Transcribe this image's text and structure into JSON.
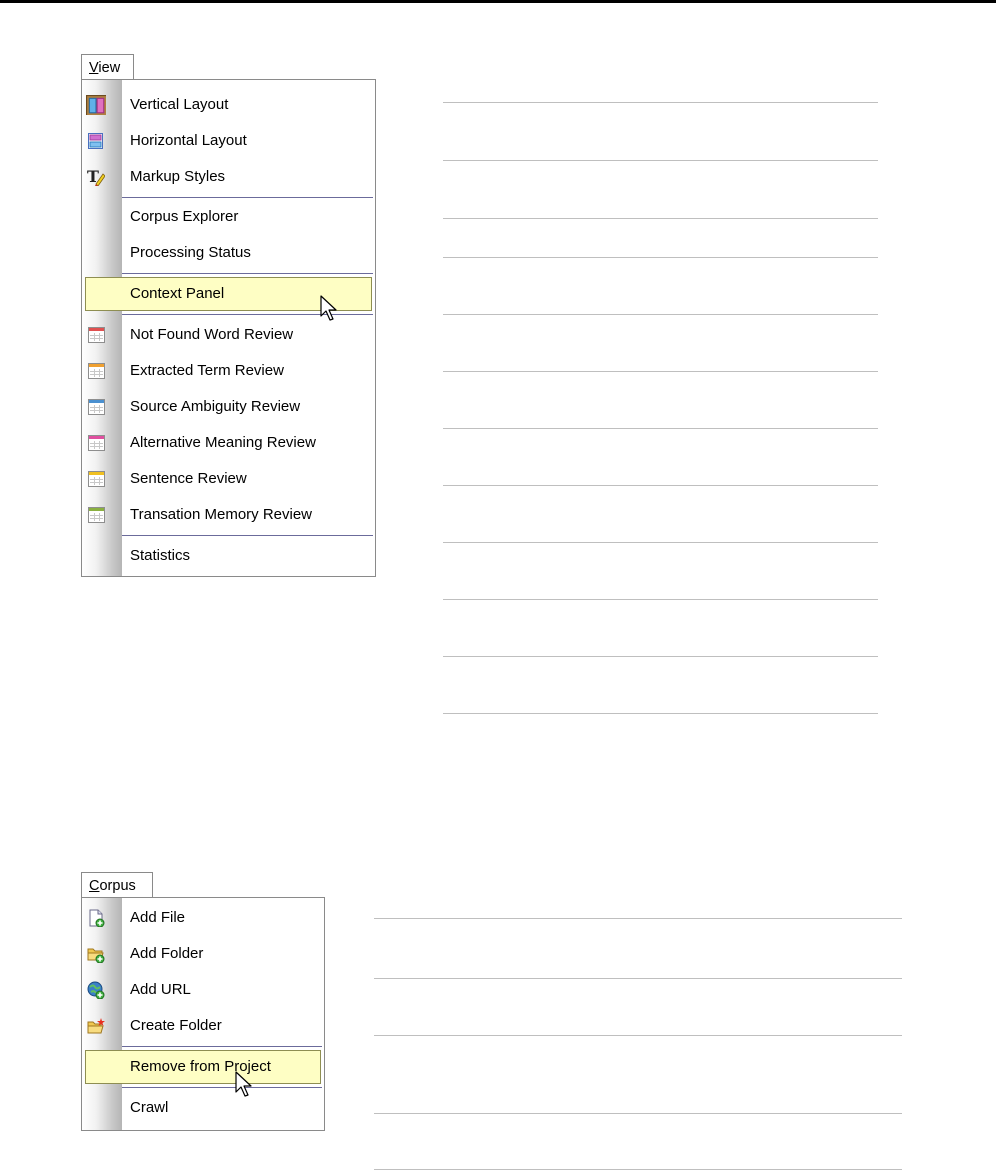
{
  "view_menu": {
    "title": "View",
    "title_accel": "V",
    "title_rest": "iew",
    "items": [
      {
        "label": "Vertical Layout",
        "icon": "vertical-layout-icon"
      },
      {
        "label": "Horizontal Layout",
        "icon": "horizontal-layout-icon"
      },
      {
        "label": "Markup Styles",
        "icon": "markup-styles-icon"
      },
      {
        "label": "Corpus Explorer",
        "icon": ""
      },
      {
        "label": "Processing Status",
        "icon": ""
      },
      {
        "label": "Context Panel",
        "icon": "",
        "highlighted": true
      },
      {
        "label": "Not Found Word Review",
        "icon": "grid-red-icon",
        "color": "#e05050"
      },
      {
        "label": "Extracted Term Review",
        "icon": "grid-orange-icon",
        "color": "#f0a030"
      },
      {
        "label": "Source Ambiguity Review",
        "icon": "grid-blue-icon",
        "color": "#4a90d0"
      },
      {
        "label": "Alternative Meaning Review",
        "icon": "grid-pink-icon",
        "color": "#e050a0"
      },
      {
        "label": "Sentence Review",
        "icon": "grid-yellow-icon",
        "color": "#f0c020"
      },
      {
        "label": "Transation Memory Review",
        "icon": "grid-green-icon",
        "color": "#8ab040"
      },
      {
        "label": "Statistics",
        "icon": ""
      }
    ]
  },
  "corpus_menu": {
    "title": "Corpus",
    "title_accel": "C",
    "title_rest": "orpus",
    "items": [
      {
        "label": "Add File",
        "icon": "add-file-icon"
      },
      {
        "label": "Add Folder",
        "icon": "add-folder-icon"
      },
      {
        "label": "Add URL",
        "icon": "add-url-icon"
      },
      {
        "label": "Create Folder",
        "icon": "create-folder-icon"
      },
      {
        "label": "Remove from Project",
        "icon": "",
        "highlighted": true
      },
      {
        "label": "Crawl",
        "icon": ""
      }
    ]
  },
  "colors": {
    "highlight_fill": "#fefec4",
    "highlight_border": "#8e8e52",
    "separator": "#6b6b9b",
    "guide_line": "#bfbfbf"
  }
}
